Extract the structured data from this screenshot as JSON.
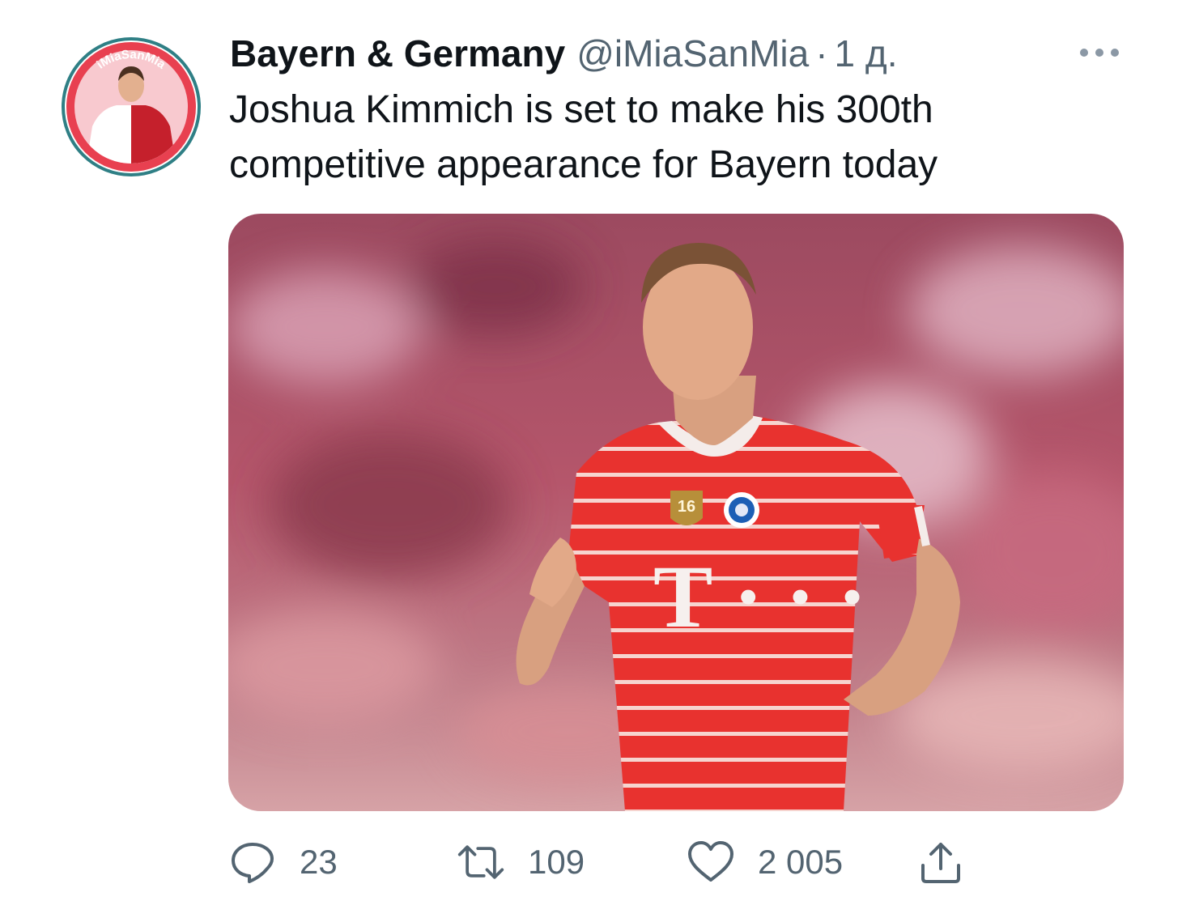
{
  "tweet": {
    "author": {
      "display_name": "Bayern & Germany",
      "handle": "@iMiaSanMia",
      "separator": "·",
      "time": "1 д."
    },
    "avatar": {
      "ring_text": "iMiaSanMia",
      "colors": {
        "ring": "#e84050",
        "outer": "#2f7f85"
      }
    },
    "text": "Joshua Kimmich is set to make his 300th competitive appearance for Bayern today",
    "media": {
      "shirt_sponsor": "T · · ·",
      "badge_number": "16",
      "colors": {
        "shirt": "#e8322f",
        "stripes": "#f6d4cf",
        "background": "#b5566b"
      }
    },
    "actions": {
      "reply": {
        "icon": "reply-icon",
        "count": "23"
      },
      "retweet": {
        "icon": "retweet-icon",
        "count": "109"
      },
      "like": {
        "icon": "heart-icon",
        "count": "2 005"
      },
      "share": {
        "icon": "share-icon"
      }
    },
    "more_icon": "more-icon",
    "colors": {
      "primary_text": "#0f1419",
      "secondary_text": "#536471"
    }
  }
}
